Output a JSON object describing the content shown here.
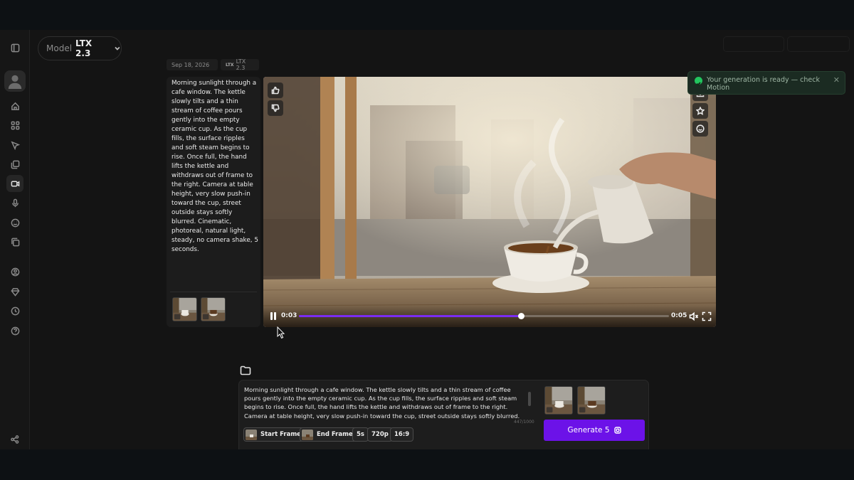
{
  "header": {
    "model_label": "Model",
    "model_value": "LTX 2.3"
  },
  "generation": {
    "date": "Sep 18, 2026",
    "model_tag_logo": "LTX",
    "model_tag": "LTX 2.3",
    "prompt": "Morning sunlight through a cafe window. The kettle slowly tilts and a thin stream of coffee pours gently into the empty ceramic cup. As the cup fills, the surface ripples and soft steam begins to rise. Once full, the hand lifts the kettle and withdraws out of frame to the right. Camera at table height, very slow push-in toward the cup, street outside stays softly blurred. Cinematic, photoreal, natural light, steady, no camera shake, 5 seconds."
  },
  "player": {
    "current_time": "0:03",
    "duration": "0:05",
    "progress": 0.6,
    "state": "playing",
    "muted": true
  },
  "toast": {
    "message": "Your generation is ready — check Motion",
    "status_color": "#22c55e"
  },
  "composer": {
    "prompt": "Morning sunlight through a cafe window. The kettle slowly tilts and a thin stream of coffee pours gently into the empty ceramic cup. As the cup fills, the surface ripples and soft steam begins to rise. Once full, the hand lifts the kettle and withdraws out of frame to the right. Camera at table height, very slow push-in toward the cup, street outside stays softly blurred. Cinematic, photoreal, natural light, steady, no camera",
    "char_count": "447/1000",
    "chips": {
      "start_frame": "Start Frame",
      "end_frame": "End Frame",
      "duration": "5s",
      "resolution": "720p",
      "aspect": "16:9"
    },
    "generate_label": "Generate 5"
  },
  "sidebar": {
    "items": [
      "sidebar-toggle-icon",
      "home-icon",
      "apps-icon",
      "cursor-icon",
      "image-copy-icon",
      "video-icon",
      "mic-icon",
      "face-icon",
      "library-icon",
      "account-icon",
      "diamond-icon",
      "history-icon",
      "help-icon",
      "share-icon"
    ]
  },
  "colors": {
    "accent": "#6c12e8",
    "progress": "#7a2cf2",
    "background": "#141414"
  }
}
